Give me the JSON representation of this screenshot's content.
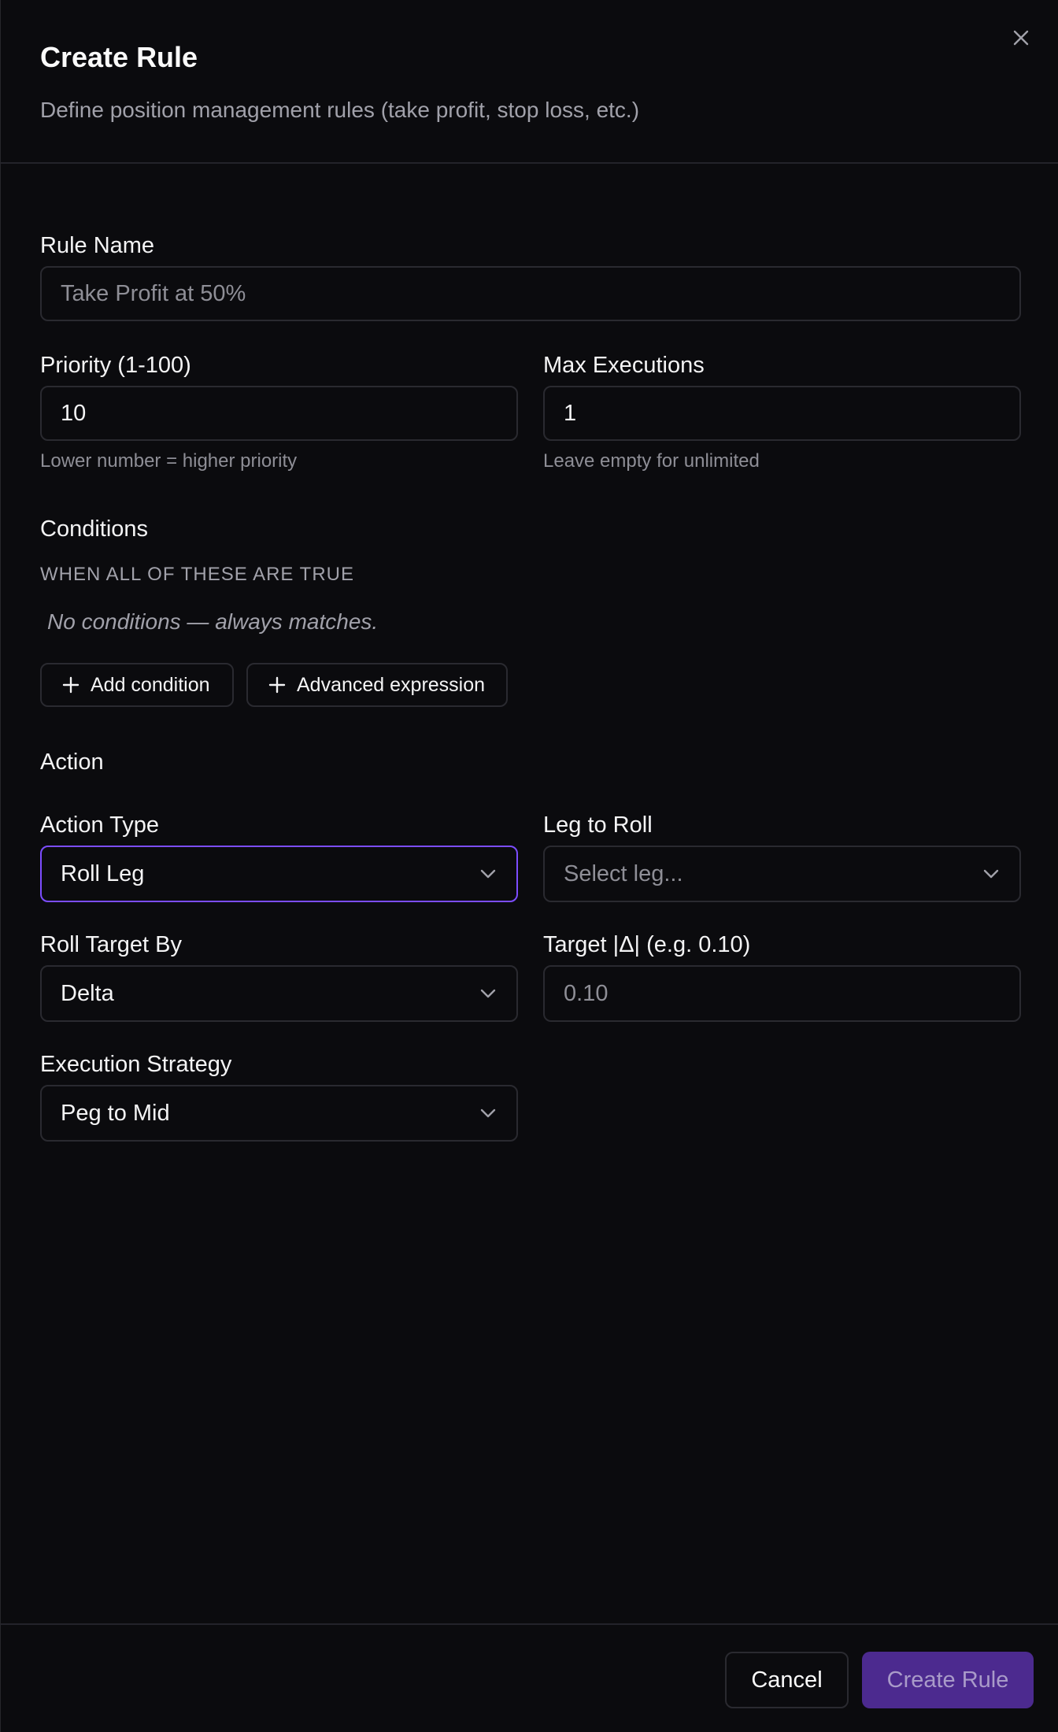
{
  "dialog": {
    "title": "Create Rule",
    "subtitle": "Define position management rules (take profit, stop loss, etc.)",
    "close_icon": "close-icon"
  },
  "form": {
    "rule_name": {
      "label": "Rule Name",
      "placeholder": "Take Profit at 50%",
      "value": ""
    },
    "priority": {
      "label": "Priority (1-100)",
      "value": "10",
      "hint": "Lower number = higher priority"
    },
    "max_executions": {
      "label": "Max Executions",
      "value": "1",
      "hint": "Leave empty for unlimited"
    }
  },
  "conditions": {
    "title": "Conditions",
    "subtitle": "WHEN ALL OF THESE ARE TRUE",
    "empty_text": "No conditions — always matches.",
    "add_condition_label": "Add condition",
    "advanced_expression_label": "Advanced expression"
  },
  "action": {
    "title": "Action",
    "action_type": {
      "label": "Action Type",
      "value": "Roll Leg"
    },
    "leg_to_roll": {
      "label": "Leg to Roll",
      "placeholder": "Select leg..."
    },
    "roll_target_by": {
      "label": "Roll Target By",
      "value": "Delta"
    },
    "target": {
      "label": "Target |Δ| (e.g. 0.10)",
      "placeholder": "0.10"
    },
    "execution_strategy": {
      "label": "Execution Strategy",
      "value": "Peg to Mid"
    }
  },
  "footer": {
    "cancel_label": "Cancel",
    "create_label": "Create Rule"
  },
  "colors": {
    "background": "#0b0b0e",
    "border": "#2a2a30",
    "accent": "#7c4dff",
    "primary_button": "#4c2a8f",
    "muted_text": "#a1a1aa"
  }
}
